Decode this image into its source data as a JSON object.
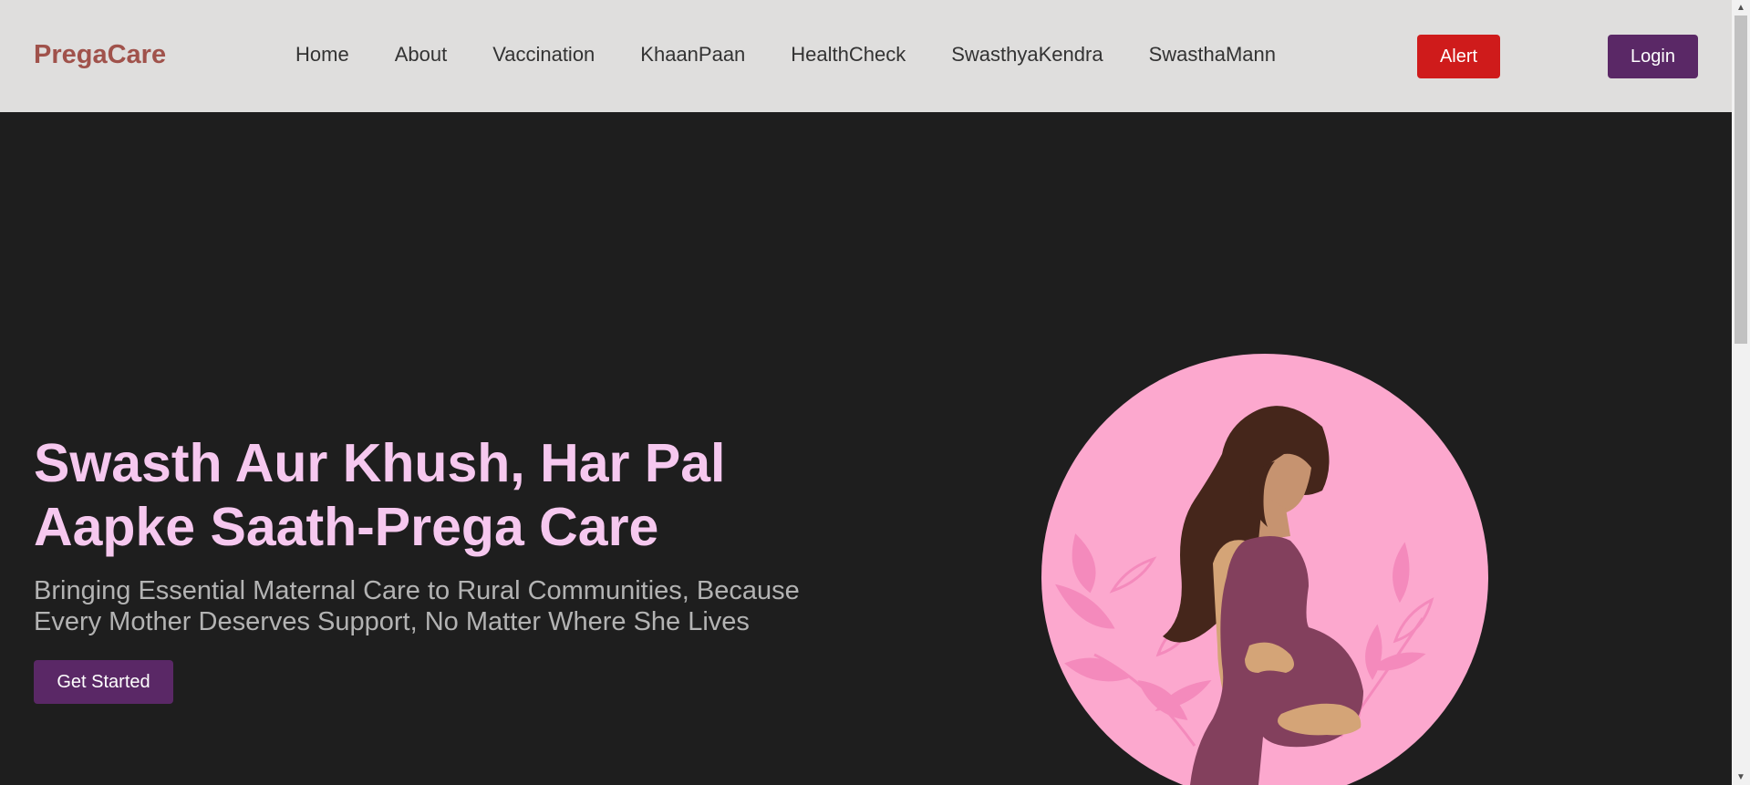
{
  "navbar": {
    "brand": "PregaCare",
    "links": [
      "Home",
      "About",
      "Vaccination",
      "KhaanPaan",
      "HealthCheck",
      "SwasthyaKendra",
      "SwasthaMann"
    ],
    "alert_label": "Alert",
    "login_label": "Login"
  },
  "hero": {
    "title": "Swasth Aur Khush, Har Pal Aapke Saath-Prega Care",
    "subtitle": "Bringing Essential Maternal Care to Rural Communities, Because Every Mother Deserves Support, No Matter Where She Lives",
    "cta_label": "Get Started"
  },
  "icons": {
    "scroll_up": "scroll-up-arrow-icon",
    "scroll_down": "scroll-down-arrow-icon",
    "illustration": "pregnant-woman-illustration"
  },
  "colors": {
    "brand": "#a0524b",
    "navbar_bg": "#dfdedd",
    "hero_bg": "#1e1e1e",
    "title": "#f6c8ef",
    "primary_button": "#5a2866",
    "alert_button": "#cf1b1b",
    "circle": "#fca8ce"
  }
}
